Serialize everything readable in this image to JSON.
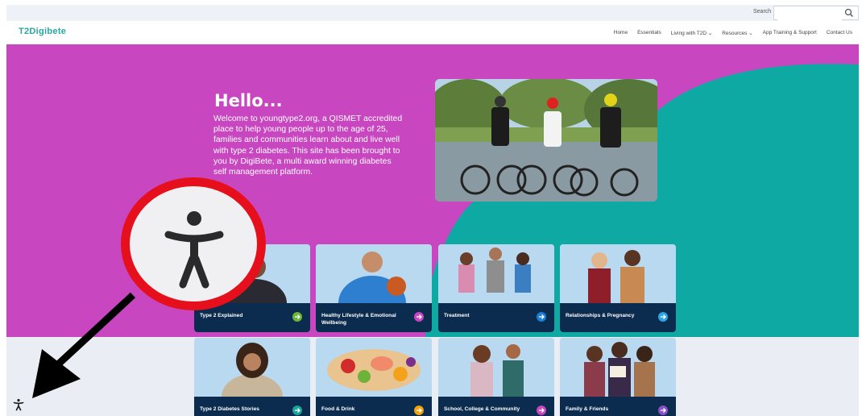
{
  "search": {
    "label": "Search",
    "placeholder": ""
  },
  "brand": {
    "logo": "T2Digibete"
  },
  "nav": {
    "items": [
      "Home",
      "Essentials",
      "Living with T2D ⌄",
      "Resources ⌄",
      "App Training & Support",
      "Contact Us"
    ]
  },
  "hero": {
    "heading": "Hello...",
    "intro": "Welcome to youngtype2.org, a QISMET accredited place to help young people up to the age of 25, families and communities learn about and live well with type 2 diabetes. This site has been brought to you by DigiBete, a multi award winning diabetes self management platform."
  },
  "cards": [
    {
      "label": "Type 2 Explained",
      "arrow_color": "#6ab534"
    },
    {
      "label": "Healthy Lifestyle & Emotional Wellbeing",
      "arrow_color": "#c847c0"
    },
    {
      "label": "Treatment",
      "arrow_color": "#1b7fd4"
    },
    {
      "label": "Relationships & Pregnancy",
      "arrow_color": "#2aa6e0"
    },
    {
      "label": "Type 2 Diabetes Stories",
      "arrow_color": "#18a59a"
    },
    {
      "label": "Food & Drink",
      "arrow_color": "#f2a20c"
    },
    {
      "label": "School, College & Community",
      "arrow_color": "#c847c0"
    },
    {
      "label": "Family & Friends",
      "arrow_color": "#8a4fc8"
    }
  ],
  "colors": {
    "magenta": "#c847c0",
    "teal": "#0fa9a3",
    "navy": "#0b2b4f",
    "highlight": "#e5101b"
  },
  "icons": [
    "search-icon",
    "accessibility-icon",
    "arrow-right-icon",
    "chevron-down-icon"
  ]
}
